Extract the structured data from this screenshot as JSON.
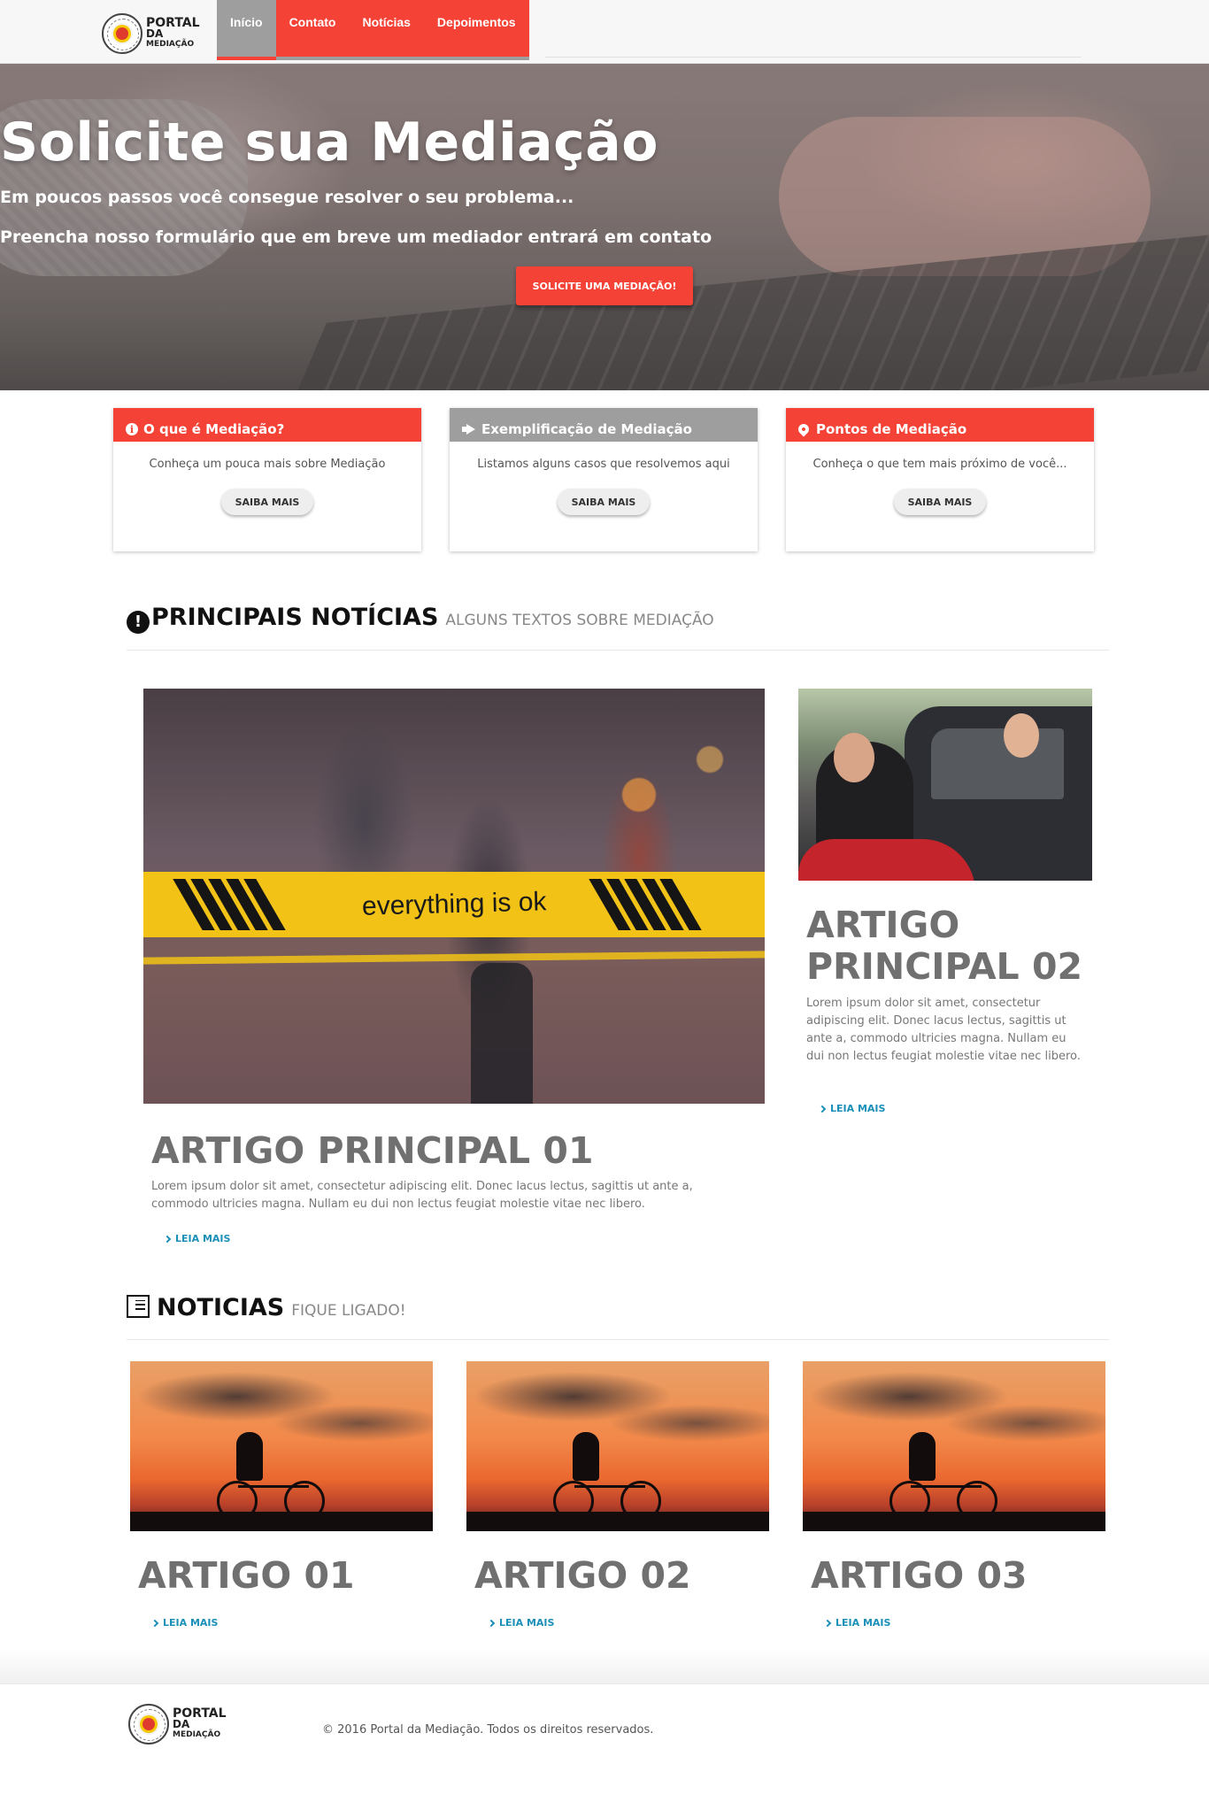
{
  "logo": {
    "line1": "PORTAL",
    "line2": "DA",
    "line3": "MEDIAÇÃO",
    "seal_text": "POLÍCIA MILITAR"
  },
  "nav": {
    "items": [
      {
        "label": "Início"
      },
      {
        "label": "Contato"
      },
      {
        "label": "Notícias"
      },
      {
        "label": "Depoimentos"
      }
    ]
  },
  "hero": {
    "title": "Solicite sua Mediação",
    "subtitle1": "Em poucos passos você consegue resolver o seu problema...",
    "subtitle2": "Preencha nosso formulário que em breve um mediador entrará em contato",
    "button": "SOLICITE UMA MEDIAÇÃO!"
  },
  "cards": [
    {
      "icon": "info-icon",
      "title": "O que é Mediação?",
      "text": "Conheça um pouca mais sobre Mediação",
      "button": "SAIBA MAIS"
    },
    {
      "icon": "megaphone-icon",
      "title": "Exemplificação de Mediação",
      "text": "Listamos alguns casos que resolvemos aqui",
      "button": "SAIBA MAIS"
    },
    {
      "icon": "map-pin-icon",
      "title": "Pontos de Mediação",
      "text": "Conheça o que tem mais próximo de você...",
      "button": "SAIBA MAIS"
    }
  ],
  "principais": {
    "title": "PRINCIPAIS NOTÍCIAS",
    "subtitle": "ALGUNS TEXTOS SOBRE MEDIAÇÃO",
    "main": {
      "image_text": "everything is ok",
      "title": "ARTIGO PRINCIPAL 01",
      "text": "Lorem ipsum dolor sit amet, consectetur adipiscing elit. Donec lacus lectus, sagittis ut ante a, commodo ultricies magna. Nullam eu dui non lectus feugiat molestie vitae nec libero.",
      "link": "LEIA MAIS"
    },
    "side": {
      "title_line1": "ARTIGO",
      "title_line2": "PRINCIPAL 02",
      "text": "Lorem ipsum dolor sit amet, consectetur adipiscing elit. Donec lacus lectus, sagittis ut ante a, commodo ultricies magna. Nullam eu dui non lectus feugiat molestie vitae nec libero.",
      "link": "LEIA MAIS"
    }
  },
  "noticias": {
    "title": "NOTICIAS",
    "subtitle": "FIQUE LIGADO!",
    "items": [
      {
        "title": "ARTIGO 01",
        "link": "LEIA MAIS"
      },
      {
        "title": "ARTIGO 02",
        "link": "LEIA MAIS"
      },
      {
        "title": "ARTIGO 03",
        "link": "LEIA MAIS"
      }
    ]
  },
  "footer": {
    "copyright": "© 2016 Portal da Mediação. Todos os direitos reservados."
  },
  "colors": {
    "accent": "#f44336",
    "gray": "#9e9e9e",
    "link": "#1a8fb8"
  }
}
